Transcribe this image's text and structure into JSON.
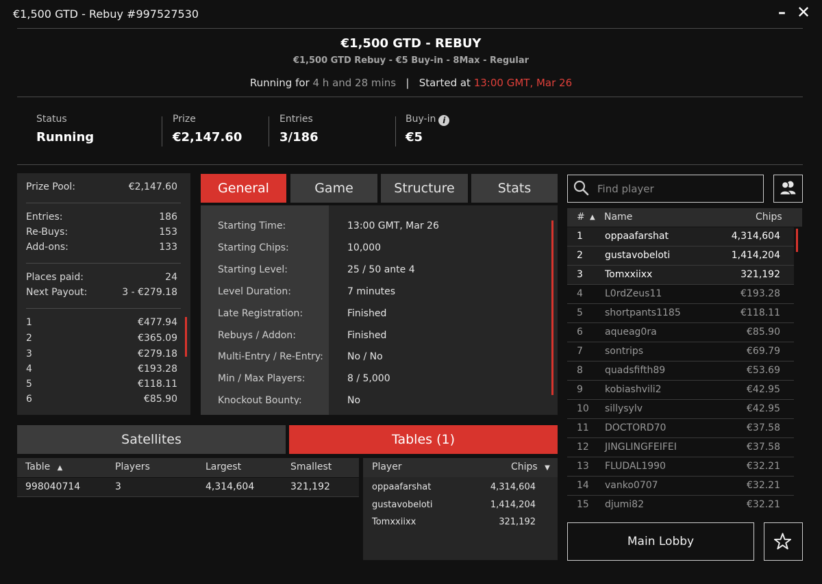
{
  "window": {
    "title": "€1,500 GTD - Rebuy #997527530",
    "minimize": "–",
    "close": "✕"
  },
  "header": {
    "title": "€1,500 GTD - REBUY",
    "subtitle": "€1,500 GTD Rebuy - €5 Buy-in - 8Max - Regular",
    "running_prefix": "Running for",
    "running_value": "4 h and 28 mins",
    "separator": "|",
    "started_prefix": "Started at",
    "started_value": "13:00 GMT, Mar 26"
  },
  "stats": {
    "status_label": "Status",
    "status_value": "Running",
    "prize_label": "Prize",
    "prize_value": "€2,147.60",
    "entries_label": "Entries",
    "entries_value": "3/186",
    "buyin_label": "Buy-in",
    "buyin_value": "€5"
  },
  "prize_panel": {
    "pool_label": "Prize Pool:",
    "pool_value": "€2,147.60",
    "entries_label": "Entries:",
    "entries_value": "186",
    "rebuys_label": "Re-Buys:",
    "rebuys_value": "153",
    "addons_label": "Add-ons:",
    "addons_value": "133",
    "places_label": "Places paid:",
    "places_value": "24",
    "next_label": "Next Payout:",
    "next_value": "3 - €279.18",
    "payouts": [
      {
        "place": "1",
        "amount": "€477.94"
      },
      {
        "place": "2",
        "amount": "€365.09"
      },
      {
        "place": "3",
        "amount": "€279.18"
      },
      {
        "place": "4",
        "amount": "€193.28"
      },
      {
        "place": "5",
        "amount": "€118.11"
      },
      {
        "place": "6",
        "amount": "€85.90"
      }
    ]
  },
  "tabs": [
    "General",
    "Game",
    "Structure",
    "Stats"
  ],
  "general": [
    {
      "label": "Starting Time:",
      "value": "13:00 GMT, Mar 26"
    },
    {
      "label": "Starting Chips:",
      "value": "10,000"
    },
    {
      "label": "Starting Level:",
      "value": "25 / 50 ante 4"
    },
    {
      "label": "Level Duration:",
      "value": "7 minutes"
    },
    {
      "label": "Late Registration:",
      "value": "Finished"
    },
    {
      "label": "Rebuys / Addon:",
      "value": "Finished"
    },
    {
      "label": "Multi-Entry / Re-Entry:",
      "value": "No / No"
    },
    {
      "label": "Min / Max Players:",
      "value": "8 / 5,000"
    },
    {
      "label": "Knockout Bounty:",
      "value": "No"
    }
  ],
  "bottom_tabs": {
    "satellites": "Satellites",
    "tables": "Tables (1)"
  },
  "tables_list": {
    "headers": {
      "table": "Table",
      "players": "Players",
      "largest": "Largest",
      "smallest": "Smallest"
    },
    "sort_arrow": "▲",
    "rows": [
      {
        "table": "998040714",
        "players": "3",
        "largest": "4,314,604",
        "smallest": "321,192"
      }
    ]
  },
  "table_players": {
    "headers": {
      "player": "Player",
      "chips": "Chips"
    },
    "sort_arrow": "▼",
    "rows": [
      {
        "name": "oppaafarshat",
        "chips": "4,314,604"
      },
      {
        "name": "gustavobeloti",
        "chips": "1,414,204"
      },
      {
        "name": "Tomxxiixx",
        "chips": "321,192"
      }
    ]
  },
  "search": {
    "placeholder": "Find player"
  },
  "players": {
    "headers": {
      "num": "#",
      "sort_arrow": "▲",
      "name": "Name",
      "chips": "Chips"
    },
    "rows": [
      {
        "num": "1",
        "name": "oppaafarshat",
        "chips": "4,314,604"
      },
      {
        "num": "2",
        "name": "gustavobeloti",
        "chips": "1,414,204"
      },
      {
        "num": "3",
        "name": "Tomxxiixx",
        "chips": "321,192"
      },
      {
        "num": "4",
        "name": "L0rdZeus11",
        "chips": "€193.28"
      },
      {
        "num": "5",
        "name": "shortpants1185",
        "chips": "€118.11"
      },
      {
        "num": "6",
        "name": "aqueag0ra",
        "chips": "€85.90"
      },
      {
        "num": "7",
        "name": "sontrips",
        "chips": "€69.79"
      },
      {
        "num": "8",
        "name": "quadsfifth89",
        "chips": "€53.69"
      },
      {
        "num": "9",
        "name": "kobiashvili2",
        "chips": "€42.95"
      },
      {
        "num": "10",
        "name": "sillysylv",
        "chips": "€42.95"
      },
      {
        "num": "11",
        "name": "DOCTORD70",
        "chips": "€37.58"
      },
      {
        "num": "12",
        "name": "JINGLINGFEIFEI",
        "chips": "€37.58"
      },
      {
        "num": "13",
        "name": "FLUDAL1990",
        "chips": "€32.21"
      },
      {
        "num": "14",
        "name": "vanko0707",
        "chips": "€32.21"
      },
      {
        "num": "15",
        "name": "djumi82",
        "chips": "€32.21"
      }
    ]
  },
  "main_lobby": "Main Lobby",
  "colors": {
    "accent": "#d8342d",
    "highlight_text": "#e0403a",
    "background": "#111111",
    "panel": "#262626"
  }
}
